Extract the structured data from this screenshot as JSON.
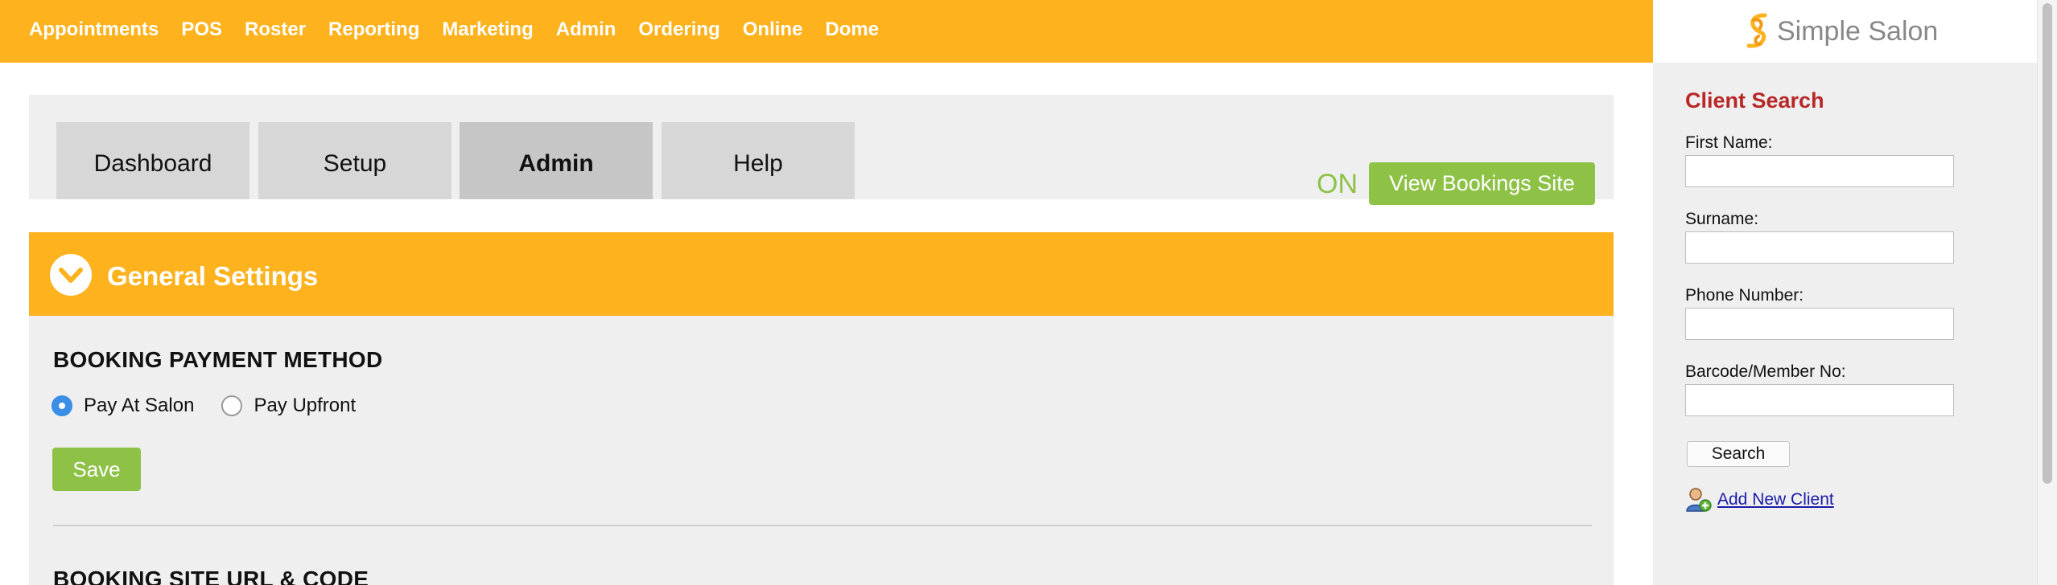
{
  "nav": {
    "items": [
      {
        "label": "Appointments"
      },
      {
        "label": "POS"
      },
      {
        "label": "Roster"
      },
      {
        "label": "Reporting"
      },
      {
        "label": "Marketing"
      },
      {
        "label": "Admin"
      },
      {
        "label": "Ordering"
      },
      {
        "label": "Online"
      },
      {
        "label": "Dome"
      }
    ]
  },
  "tabs": {
    "items": [
      {
        "label": "Dashboard"
      },
      {
        "label": "Setup"
      },
      {
        "label": "Admin",
        "active": true
      },
      {
        "label": "Help"
      }
    ]
  },
  "bookings": {
    "status": "ON",
    "view_site_label": "View Bookings Site"
  },
  "section": {
    "title": "General Settings",
    "payment_heading": "BOOKING PAYMENT METHOD",
    "options": [
      {
        "label": "Pay At Salon",
        "checked": true
      },
      {
        "label": "Pay Upfront",
        "checked": false
      }
    ],
    "save_label": "Save",
    "url_heading": "BOOKING SITE URL & CODE"
  },
  "brand": {
    "name": "Simple Salon"
  },
  "client_search": {
    "title": "Client Search",
    "first_name_label": "First Name:",
    "first_name_value": "",
    "surname_label": "Surname:",
    "surname_value": "",
    "phone_label": "Phone Number:",
    "phone_value": "",
    "barcode_label": "Barcode/Member No:",
    "barcode_value": "",
    "search_label": "Search",
    "add_client_label": "Add New Client"
  },
  "colors": {
    "accent": "#fdb21e",
    "success": "#8ec247",
    "title_red": "#b82727",
    "panel_bg": "#efefef"
  },
  "icons": {
    "section_toggle": "chevron-down-icon",
    "brand_logo": "simple-salon-logo-icon",
    "add_client": "add-user-icon"
  }
}
